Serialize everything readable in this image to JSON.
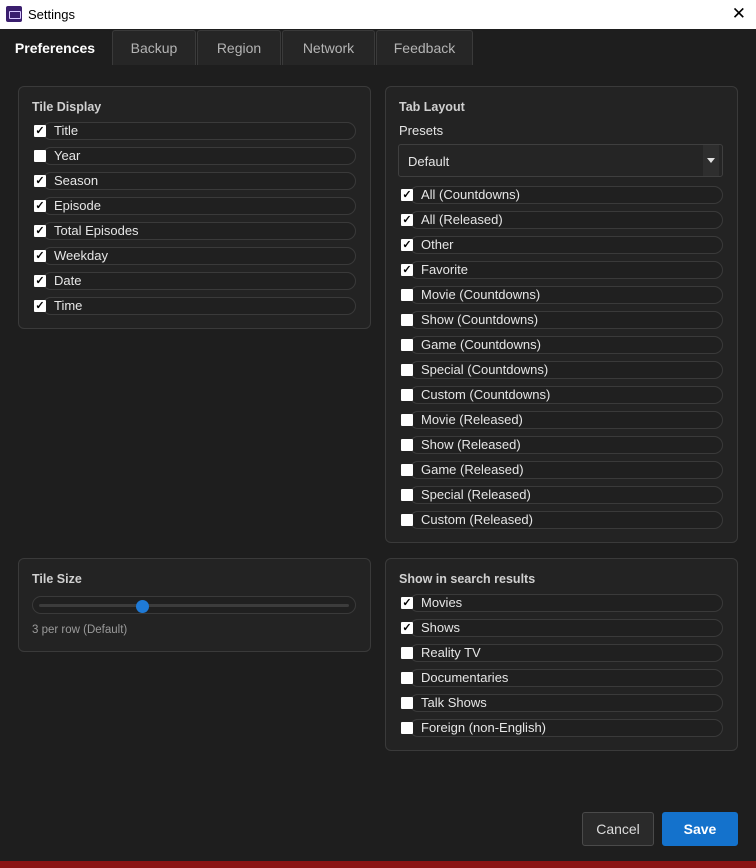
{
  "window": {
    "title": "Settings"
  },
  "tabs": [
    {
      "label": "Preferences",
      "active": true
    },
    {
      "label": "Backup",
      "active": false
    },
    {
      "label": "Region",
      "active": false
    },
    {
      "label": "Network",
      "active": false
    },
    {
      "label": "Feedback",
      "active": false
    }
  ],
  "tile_display": {
    "title": "Tile Display",
    "items": [
      {
        "label": "Title",
        "checked": true
      },
      {
        "label": "Year",
        "checked": false
      },
      {
        "label": "Season",
        "checked": true
      },
      {
        "label": "Episode",
        "checked": true
      },
      {
        "label": "Total Episodes",
        "checked": true
      },
      {
        "label": "Weekday",
        "checked": true
      },
      {
        "label": "Date",
        "checked": true
      },
      {
        "label": "Time",
        "checked": true
      }
    ]
  },
  "tab_layout": {
    "title": "Tab Layout",
    "presets_label": "Presets",
    "presets_value": "Default",
    "items": [
      {
        "label": "All (Countdowns)",
        "checked": true
      },
      {
        "label": "All (Released)",
        "checked": true
      },
      {
        "label": "Other",
        "checked": true
      },
      {
        "label": "Favorite",
        "checked": true
      },
      {
        "label": "Movie (Countdowns)",
        "checked": false
      },
      {
        "label": "Show (Countdowns)",
        "checked": false
      },
      {
        "label": "Game (Countdowns)",
        "checked": false
      },
      {
        "label": "Special (Countdowns)",
        "checked": false
      },
      {
        "label": "Custom (Countdowns)",
        "checked": false
      },
      {
        "label": "Movie (Released)",
        "checked": false
      },
      {
        "label": "Show (Released)",
        "checked": false
      },
      {
        "label": "Game (Released)",
        "checked": false
      },
      {
        "label": "Special (Released)",
        "checked": false
      },
      {
        "label": "Custom (Released)",
        "checked": false
      }
    ]
  },
  "tile_size": {
    "title": "Tile Size",
    "slider_fraction": 0.34,
    "caption": "3 per row (Default)"
  },
  "search_results": {
    "title": "Show in search results",
    "items": [
      {
        "label": "Movies",
        "checked": true
      },
      {
        "label": "Shows",
        "checked": true
      },
      {
        "label": "Reality TV",
        "checked": false
      },
      {
        "label": "Documentaries",
        "checked": false
      },
      {
        "label": "Talk Shows",
        "checked": false
      },
      {
        "label": "Foreign (non-English)",
        "checked": false
      }
    ]
  },
  "buttons": {
    "cancel": "Cancel",
    "save": "Save"
  },
  "colors": {
    "accent": "#1472cc",
    "background": "#1e1e1e",
    "panel": "#232323"
  }
}
